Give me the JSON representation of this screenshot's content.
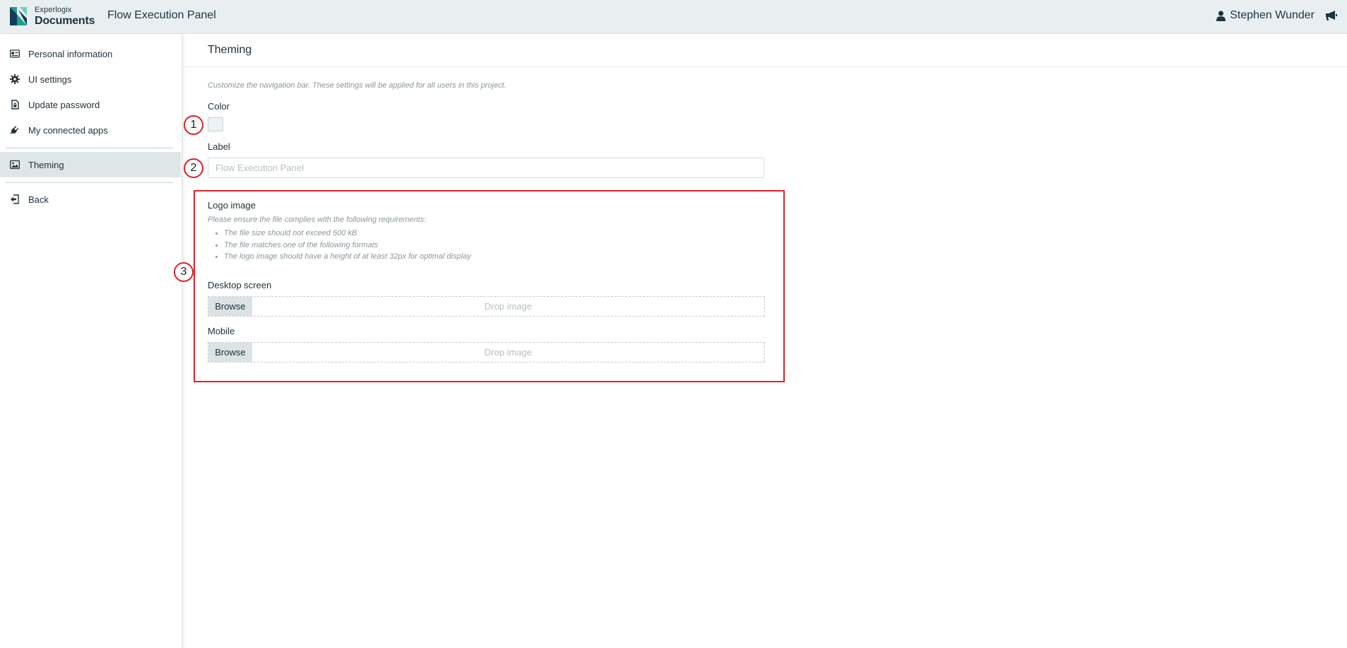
{
  "header": {
    "brand_small": "Experlogix",
    "brand_big": "Documents",
    "app_title": "Flow Execution Panel",
    "user_name": "Stephen Wunder",
    "icons": [
      "experlogix-logo-icon",
      "user-icon",
      "megaphone-icon"
    ]
  },
  "sidebar": {
    "items": [
      {
        "label": "Personal information",
        "icon": "id-card-icon"
      },
      {
        "label": "UI settings",
        "icon": "gear-icon"
      },
      {
        "label": "Update password",
        "icon": "lock-icon"
      },
      {
        "label": "My connected apps",
        "icon": "plug-icon"
      },
      {
        "label": "Theming",
        "icon": "image-icon",
        "active": true
      },
      {
        "label": "Back",
        "icon": "back-icon"
      }
    ]
  },
  "main": {
    "title": "Theming",
    "hint": "Customize the navigation bar. These settings will be applied for all users in this project.",
    "color_label": "Color",
    "label_label": "Label",
    "label_placeholder": "Flow Execution Panel",
    "label_value": "",
    "logo_label": "Logo image",
    "requirements_intro": "Please ensure the file complies with the following requirements:",
    "requirements": [
      "The file size should not exceed 500 kB",
      "The file matches one of the following formats",
      "The logo image should have a height of at least 32px for optimal display"
    ],
    "desktop_label": "Desktop screen",
    "mobile_label": "Mobile",
    "browse_label": "Browse",
    "drop_label": "Drop image"
  },
  "annotations": {
    "markers": [
      "1",
      "2",
      "3"
    ]
  },
  "colors": {
    "accent_red": "#e0212b",
    "header_bg": "#e9eff0",
    "active_item_bg": "#dfe6e8",
    "logo_green": "#1aa58a",
    "logo_dark": "#17395a"
  }
}
